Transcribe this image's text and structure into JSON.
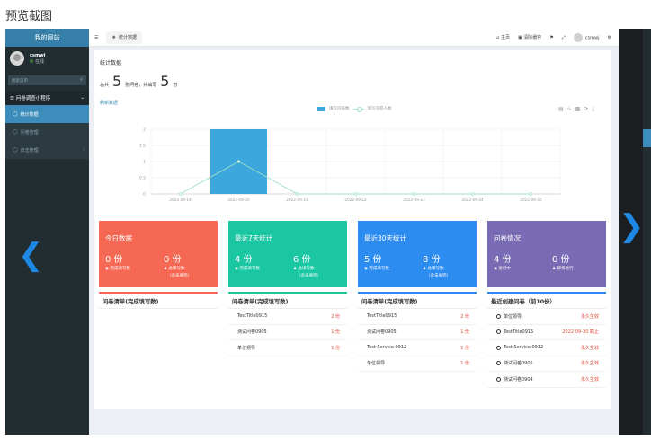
{
  "caption": "预览截图",
  "sidebar": {
    "brand": "我的网站",
    "user_name": "csmwj",
    "user_status": "在线",
    "search_placeholder": "搜索菜单",
    "group": "问卷调查小程序",
    "items": [
      {
        "label": "统计数据",
        "active": true
      },
      {
        "label": "问卷管理",
        "active": false
      },
      {
        "label": "日志管理",
        "active": false
      }
    ]
  },
  "topbar": {
    "tab_label": "统计数据",
    "home": "主页",
    "clear_cache": "清除缓存",
    "user": "csmwj"
  },
  "summary": {
    "title": "统计数据",
    "prefix": "总共",
    "total": "5",
    "mid": "张问卷，共填写",
    "filled": "5",
    "suffix": "份",
    "refresh": "刷新数据"
  },
  "chart_data": {
    "type": "bar",
    "categories": [
      "2022-09-19",
      "2022-09-20",
      "2022-09-21",
      "2022-09-22",
      "2022-09-23",
      "2022-09-24",
      "2022-09-25"
    ],
    "series": [
      {
        "name": "填写问卷数",
        "type": "bar",
        "values": [
          0,
          2,
          0,
          0,
          0,
          0,
          0
        ]
      },
      {
        "name": "填写问卷人数",
        "type": "line",
        "values": [
          0,
          1,
          0,
          0,
          0,
          0,
          0
        ]
      }
    ],
    "y_ticks": [
      "0",
      "0.5",
      "1",
      "1.5",
      "2"
    ],
    "ylim": [
      0,
      2
    ],
    "grid": true,
    "legend_position": "top-center",
    "colors": {
      "bar": "#3ca7dd",
      "line": "#9be0c6"
    }
  },
  "cards": [
    {
      "title": "今日数据",
      "v1": "0 份",
      "l1": "完成填写数",
      "v2": "0 份",
      "l2": "总填写数",
      "n2": "（含未填完）",
      "color": "#f56954"
    },
    {
      "title": "最近7天统计",
      "v1": "4 份",
      "l1": "完成填写数",
      "v2": "6 份",
      "l2": "总填写数",
      "n2": "（含未填完）",
      "color": "#1bc6a3"
    },
    {
      "title": "最近30天统计",
      "v1": "5 份",
      "l1": "完成填写数",
      "v2": "8 份",
      "l2": "总填写数",
      "n2": "（含未填完）",
      "color": "#2d8cf0"
    },
    {
      "title": "问卷情况",
      "v1": "4 份",
      "l1": "进行中",
      "v2": "0 份",
      "l2": "即将进行",
      "n2": "",
      "color": "#7a6bb5"
    }
  ],
  "lists": [
    {
      "title": "问卷清单(完成填写数)",
      "bar_color": "#f56954",
      "rows": []
    },
    {
      "title": "问卷清单(完成填写数)",
      "bar_color": "#1bc6a3",
      "rows": [
        {
          "name": "TestTitle0915",
          "value": "2 份"
        },
        {
          "name": "测试问卷0905",
          "value": "1 份"
        },
        {
          "name": "单位领导",
          "value": "1 份"
        }
      ]
    },
    {
      "title": "问卷清单(完成填写数)",
      "bar_color": "#2d8cf0",
      "rows": [
        {
          "name": "TestTitle0915",
          "value": "2 份"
        },
        {
          "name": "测试问卷0905",
          "value": "1 份"
        },
        {
          "name": "Test Service 0912",
          "value": "1 份"
        },
        {
          "name": "单位领导",
          "value": "1 份"
        }
      ]
    },
    {
      "title": "最近创建问卷（前10份）",
      "bar_color": "#2d8cf0",
      "rows": [
        {
          "name": "单位领导",
          "value": "永久生效"
        },
        {
          "name": "TestTitle0915",
          "value": "2022-09-30 截止"
        },
        {
          "name": "Test Service 0912",
          "value": "永久生效"
        },
        {
          "name": "测试问卷0905",
          "value": "永久生效"
        },
        {
          "name": "测试问卷0904",
          "value": "永久生效"
        }
      ]
    }
  ],
  "icons": {
    "prev": "chevron-left-icon",
    "next": "chevron-right-icon"
  }
}
